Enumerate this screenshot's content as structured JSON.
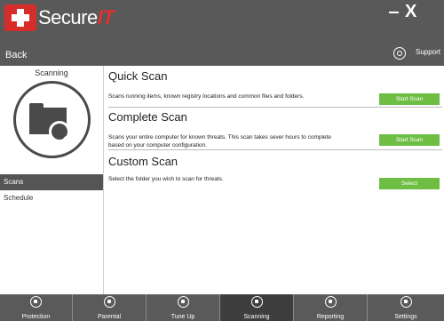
{
  "app": {
    "name_main": "Secure",
    "name_accent": "IT",
    "close_glyph": "X"
  },
  "header": {
    "back_label": "Back",
    "support_label": "Support"
  },
  "sidebar": {
    "title": "Scanning",
    "items": [
      {
        "label": "Scans",
        "active": true
      },
      {
        "label": "Schedule",
        "active": false
      }
    ]
  },
  "main": {
    "sections": [
      {
        "title": "Quick Scan",
        "description": "Scans running items, known registry locations and common files and folders.",
        "button": "Start Scan"
      },
      {
        "title": "Complete Scan",
        "description": "Scans your entire computer for known threats. This scan takes sever hours to complete based on your computer configuration.",
        "button": "Start Scan"
      },
      {
        "title": "Custom Scan",
        "description": "Select the folder you wish to scan for threats.",
        "button": "Select"
      }
    ]
  },
  "bottom_tabs": [
    {
      "label": "Protection",
      "icon": "lock-icon"
    },
    {
      "label": "Parental",
      "icon": "people-icon"
    },
    {
      "label": "Tune Up",
      "icon": "monitor-icon"
    },
    {
      "label": "Scanning",
      "icon": "scan-icon",
      "active": true
    },
    {
      "label": "Reporting",
      "icon": "report-icon"
    },
    {
      "label": "Settings",
      "icon": "gear-icon"
    }
  ],
  "colors": {
    "accent": "#6fbe44",
    "brand_red": "#d72d2a",
    "header": "#595959"
  }
}
